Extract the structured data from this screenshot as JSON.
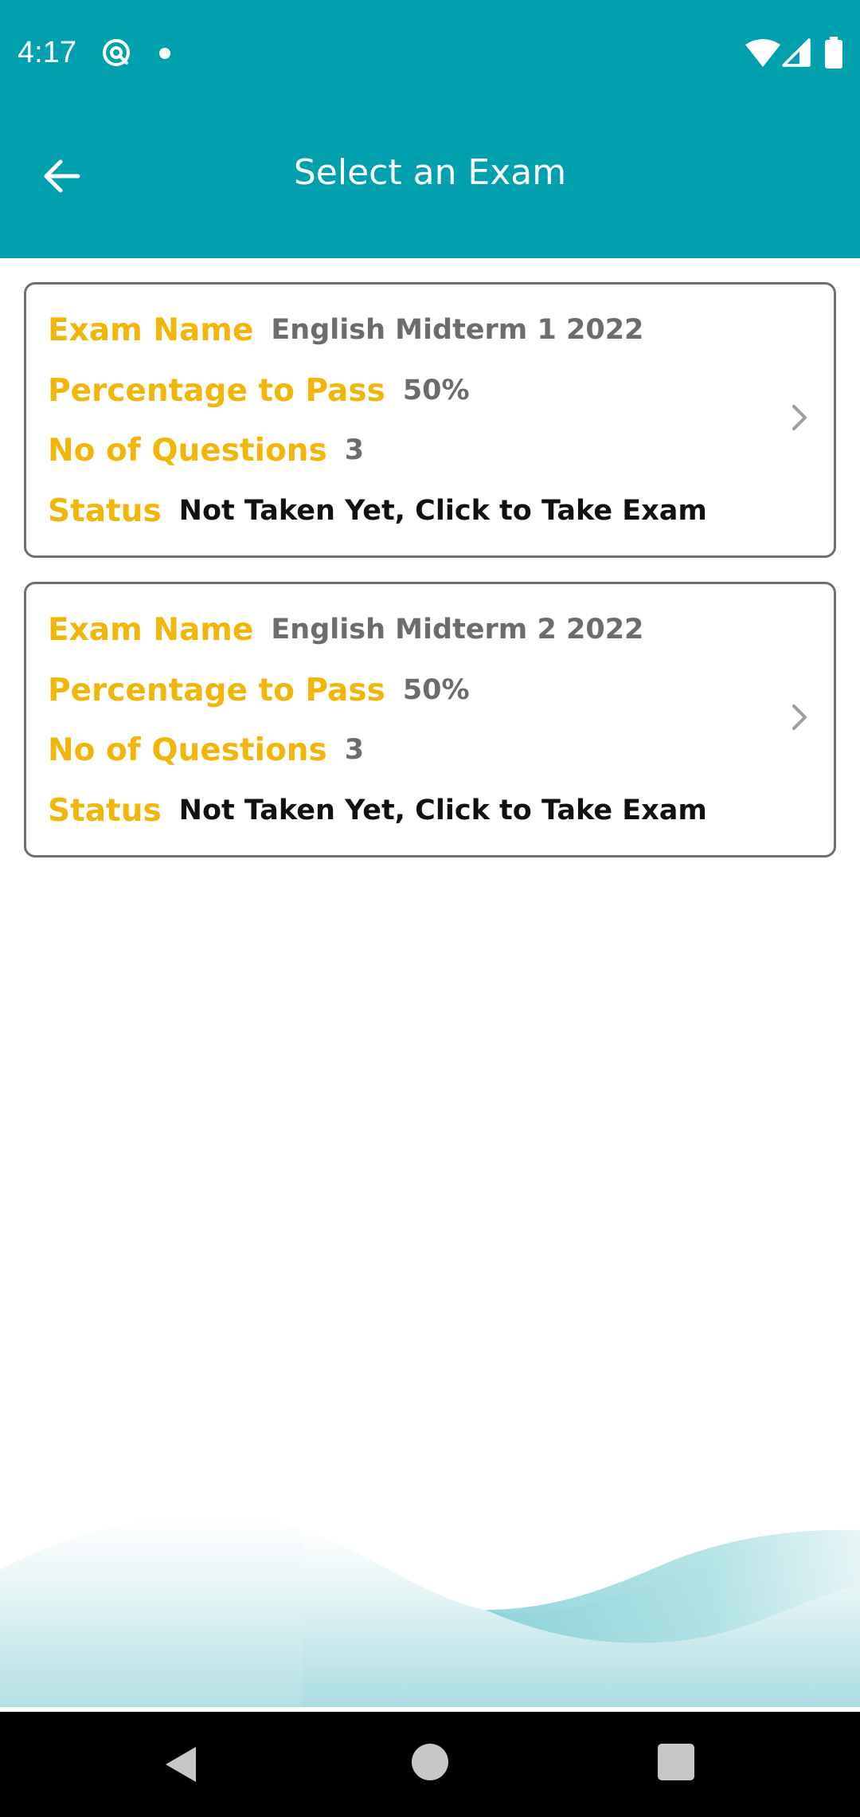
{
  "status_bar": {
    "time": "4:17",
    "icons": [
      "at-sign-icon",
      "notification-dot-icon",
      "wifi-icon",
      "cell-signal-icon",
      "battery-icon"
    ]
  },
  "app_bar": {
    "title": "Select an Exam",
    "back_icon": "arrow-left-icon"
  },
  "exams": [
    {
      "name_label": "Exam Name",
      "name": "English Midterm 1 2022",
      "pass_label": "Percentage to Pass",
      "pass": "50%",
      "questions_label": "No of Questions",
      "questions": "3",
      "status_label": "Status",
      "status": "Not Taken Yet, Click to Take Exam"
    },
    {
      "name_label": "Exam Name",
      "name": "English Midterm 2 2022",
      "pass_label": "Percentage to Pass",
      "pass": "50%",
      "questions_label": "No of Questions",
      "questions": "3",
      "status_label": "Status",
      "status": "Not Taken Yet, Click to Take Exam"
    }
  ],
  "nav_bar": {
    "icons": [
      "nav-back-icon",
      "nav-home-icon",
      "nav-recents-icon"
    ]
  },
  "colors": {
    "primary": "#00a0ae",
    "label": "#f2b60a",
    "value": "#6c6c6c",
    "status_text": "#111111",
    "card_border": "#6f6f6f"
  }
}
